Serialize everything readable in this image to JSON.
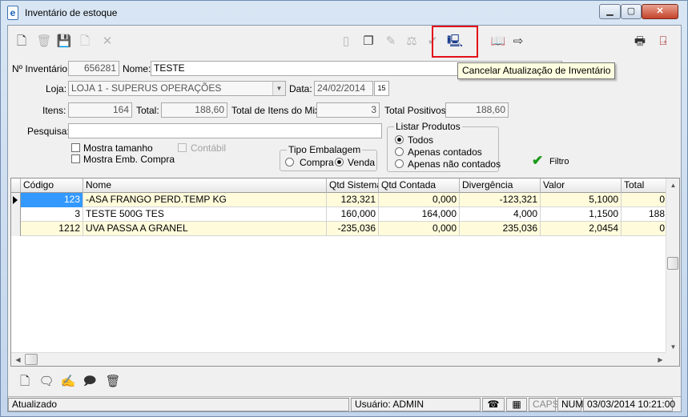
{
  "window": {
    "title": "Inventário de estoque",
    "icon_letter": "e"
  },
  "toolbar": {
    "left_icons": [
      "new-doc-icon",
      "delete-icon",
      "save-icon",
      "copy-doc-icon",
      "cancel-x-icon"
    ],
    "middle_icons": [
      "blank-icon",
      "duplicate-icon",
      "brush-icon",
      "scale-icon",
      "check-icon",
      "cancel-update-icon"
    ],
    "right_icons": [
      "book-icon",
      "export-icon",
      "print-icon",
      "exit-door-icon"
    ],
    "tooltip": "Cancelar Atualização de Inventário"
  },
  "form": {
    "inventario_label": "Nº Inventário:",
    "inventario_value": "656281",
    "nome_label": "Nome:",
    "nome_value": "TESTE",
    "loja_label": "Loja:",
    "loja_value": "LOJA 1 - SUPERUS OPERAÇÕES",
    "data_label": "Data:",
    "data_value": "24/02/2014",
    "date_button": "15",
    "itens_label": "Itens:",
    "itens_value": "164",
    "total_label": "Total:",
    "total_value": "188,60",
    "mix_label": "Total de Itens do Mix:",
    "mix_value": "3",
    "positivos_label": "Total Positivos:",
    "positivos_value": "188,60",
    "pesquisa_label": "Pesquisa:",
    "pesquisa_value": "",
    "mostra_tamanho": "Mostra tamanho",
    "mostra_emb": "Mostra Emb. Compra",
    "contabil": "Contábil",
    "tipo_embalagem": {
      "title": "Tipo Embalagem",
      "compra": "Compra",
      "venda": "Venda",
      "selected": "Venda"
    },
    "listar_produtos": {
      "title": "Listar Produtos",
      "todos": "Todos",
      "contados": "Apenas contados",
      "nao_contados": "Apenas não contados",
      "selected": "Todos"
    },
    "filtro_label": "Filtro"
  },
  "grid": {
    "columns": [
      "Código",
      "Nome",
      "Qtd Sistema",
      "Qtd Contada",
      "Divergência",
      "Valor",
      "Total"
    ],
    "rows": [
      {
        "codigo": "123",
        "nome": "-ASA FRANGO PERD.TEMP KG",
        "qtd_sistema": "123,321",
        "qtd_contada": "0,000",
        "divergencia": "-123,321",
        "valor": "5,1000",
        "total": "0"
      },
      {
        "codigo": "3",
        "nome": "TESTE 500G TES",
        "qtd_sistema": "160,000",
        "qtd_contada": "164,000",
        "divergencia": "4,000",
        "valor": "1,1500",
        "total": "188"
      },
      {
        "codigo": "1212",
        "nome": "UVA PASSA A GRANEL",
        "qtd_sistema": "-235,036",
        "qtd_contada": "0,000",
        "divergencia": "235,036",
        "valor": "2,0454",
        "total": "0"
      }
    ]
  },
  "bottom_toolbar": [
    "new-item-icon",
    "edit-comment-icon",
    "edit-pencil-icon",
    "comment-icon",
    "trash-icon"
  ],
  "status": {
    "text": "Atualizado",
    "user": "Usuário: ADMIN",
    "caps": "CAPS",
    "num": "NUM",
    "datetime": "03/03/2014 10:21:00"
  }
}
